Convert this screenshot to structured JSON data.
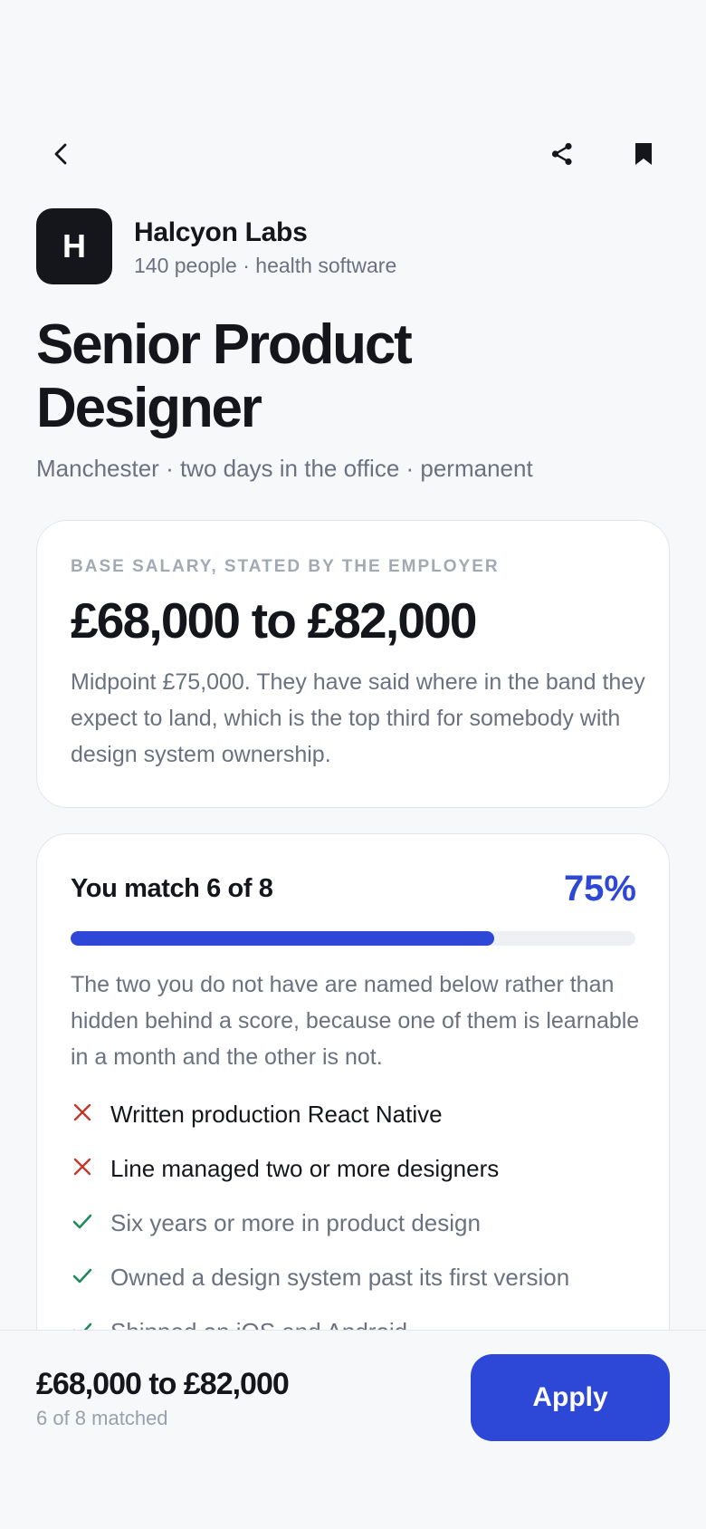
{
  "company": {
    "logo_letter": "H",
    "name": "Halcyon Labs",
    "meta": "140 people · health software"
  },
  "job": {
    "title_line1": "Senior Product",
    "title_line2": "Designer",
    "subtitle": "Manchester · two days in the office · permanent"
  },
  "salary": {
    "label": "BASE SALARY, STATED BY THE EMPLOYER",
    "range": "£68,000 to £82,000",
    "description": "Midpoint £75,000. They have said where in the band they expect to land, which is the top third for somebody with design system ownership."
  },
  "match": {
    "title": "You match 6 of 8",
    "percent_label": "75%",
    "progress": 0.75,
    "description": "The two you do not have are named below rather than hidden behind a score, because one of them is learnable in a month and the other is not.",
    "requirements": [
      {
        "text": "Written production React Native",
        "status": "missing",
        "icon": "x-icon"
      },
      {
        "text": "Line managed two or more designers",
        "status": "missing",
        "icon": "x-icon"
      },
      {
        "text": "Six years or more in product design",
        "status": "met",
        "icon": "check-icon"
      },
      {
        "text": "Owned a design system past its first version",
        "status": "met",
        "icon": "check-icon"
      },
      {
        "text": "Shipped on iOS and Android",
        "status": "met",
        "icon": "check-icon"
      }
    ]
  },
  "bottom": {
    "salary": "£68,000 to £82,000",
    "matched": "6 of 8 matched",
    "apply_label": "Apply"
  },
  "icons": {
    "back": "chevron-left-icon",
    "share": "share-icon",
    "bookmark": "bookmark-icon"
  },
  "colors": {
    "accent": "#2d47d6",
    "missing": "#c0392b",
    "met": "#1f8a5b",
    "text": "#14161c",
    "muted": "#6b7180"
  }
}
